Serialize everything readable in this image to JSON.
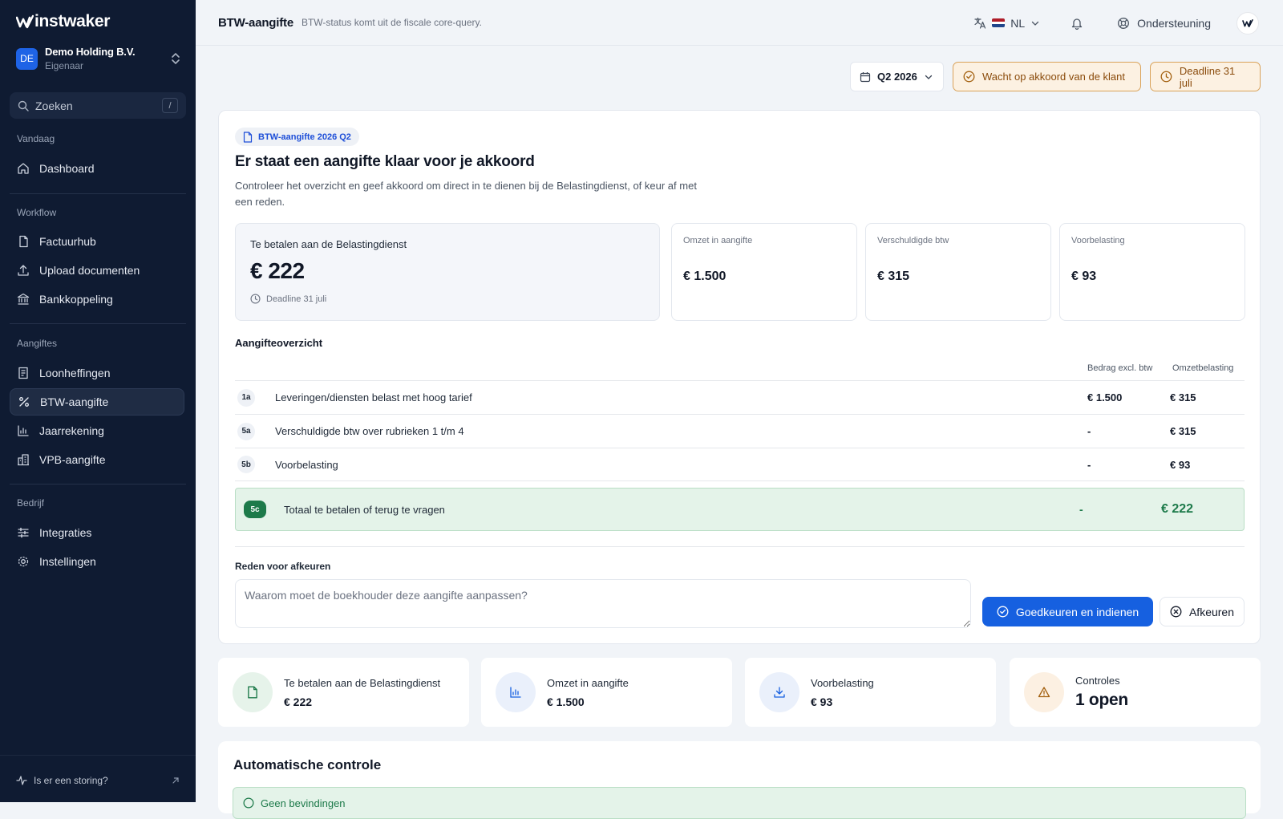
{
  "app": {
    "logo_text": "instwaker"
  },
  "org": {
    "badge": "DE",
    "name": "Demo Holding B.V.",
    "role": "Eigenaar"
  },
  "search": {
    "label": "Zoeken",
    "shortcut": "/"
  },
  "nav": {
    "today_label": "Vandaag",
    "dashboard": "Dashboard",
    "workflow_label": "Workflow",
    "factuurhub": "Factuurhub",
    "upload": "Upload documenten",
    "bank": "Bankkoppeling",
    "aangiftes_label": "Aangiftes",
    "loon": "Loonheffingen",
    "btw": "BTW-aangifte",
    "jaar": "Jaarrekening",
    "vpb": "VPB-aangifte",
    "bedrijf_label": "Bedrijf",
    "integraties": "Integraties",
    "instellingen": "Instellingen",
    "storing": "Is er een storing?"
  },
  "topbar": {
    "title": "BTW-aangifte",
    "subtitle": "BTW-status komt uit de fiscale core-query.",
    "language": "NL",
    "support": "Ondersteuning"
  },
  "actions": {
    "period": "Q2 2026",
    "status": "Wacht op akkoord van de klant",
    "deadline": "Deadline 31 juli"
  },
  "card": {
    "tag": "BTW-aangifte 2026 Q2",
    "title": "Er staat een aangifte klaar voor je akkoord",
    "description": "Controleer het overzicht en geef akkoord om direct in te dienen bij de Belastingdienst, of keur af met een reden.",
    "main_kpi": {
      "label": "Te betalen aan de Belastingdienst",
      "value": "€ 222",
      "deadline": "Deadline 31 juli"
    },
    "kpis": [
      {
        "label": "Omzet in aangifte",
        "value": "€ 1.500"
      },
      {
        "label": "Verschuldigde btw",
        "value": "€ 315"
      },
      {
        "label": "Voorbelasting",
        "value": "€ 93"
      }
    ],
    "overview_title": "Aangifteoverzicht",
    "columns": {
      "amount": "Bedrag excl. btw",
      "vat": "Omzetbelasting"
    },
    "rows": [
      {
        "code": "1a",
        "desc": "Leveringen/diensten belast met hoog tarief",
        "amount": "€ 1.500",
        "vat": "€ 315"
      },
      {
        "code": "5a",
        "desc": "Verschuldigde btw over rubrieken 1 t/m 4",
        "amount": "-",
        "vat": "€ 315"
      },
      {
        "code": "5b",
        "desc": "Voorbelasting",
        "amount": "-",
        "vat": "€ 93"
      }
    ],
    "total": {
      "code": "5c",
      "desc": "Totaal te betalen of terug te vragen",
      "amount": "-",
      "vat": "€ 222"
    },
    "reason_label": "Reden voor afkeuren",
    "reason_placeholder": "Waarom moet de boekhouder deze aangifte aanpassen?",
    "approve": "Goedkeuren en indienen",
    "reject": "Afkeuren"
  },
  "summary": [
    {
      "label": "Te betalen aan de Belastingdienst",
      "value": "€ 222"
    },
    {
      "label": "Omzet in aangifte",
      "value": "€ 1.500"
    },
    {
      "label": "Voorbelasting",
      "value": "€ 93"
    },
    {
      "label": "Controles",
      "value": "1 open"
    }
  ],
  "auto_check": {
    "title": "Automatische controle",
    "first_item": "Geen bevindingen"
  },
  "colors": {
    "sidebar": "#0f1b32",
    "primary": "#1660e0",
    "warning": "#d9a25a",
    "success": "#1d7a4a"
  }
}
